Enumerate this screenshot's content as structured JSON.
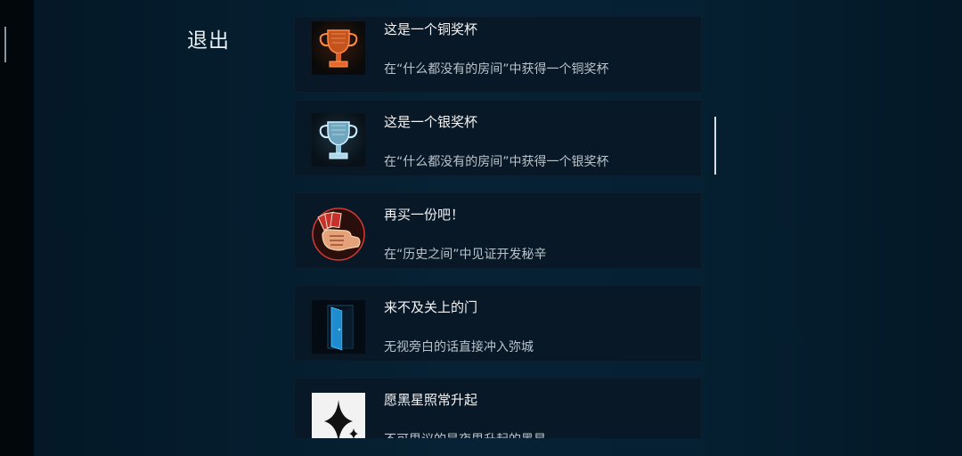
{
  "exit_label": "退出",
  "achievements": [
    {
      "title": "这是一个铜奖杯",
      "desc": "在“什么都没有的房间”中获得一个铜奖杯",
      "icon": "bronze-trophy-icon"
    },
    {
      "title": "这是一个银奖杯",
      "desc": "在“什么都没有的房间”中获得一个银奖杯",
      "icon": "silver-trophy-icon"
    },
    {
      "title": "再买一份吧！",
      "desc": "在“历史之间”中见证开发秘辛",
      "icon": "fist-cards-icon"
    },
    {
      "title": "来不及关上的门",
      "desc": "无视旁白的话直接冲入弥城",
      "icon": "open-door-icon"
    },
    {
      "title": "愿黑星照常升起",
      "desc": "不可思议的是夜里升起的黑星",
      "icon": "black-star-icon"
    }
  ],
  "colors": {
    "bronze": "#e8672a",
    "silver": "#a9d8ee",
    "red": "#d23b34",
    "door_blue": "#1e8ccf"
  }
}
